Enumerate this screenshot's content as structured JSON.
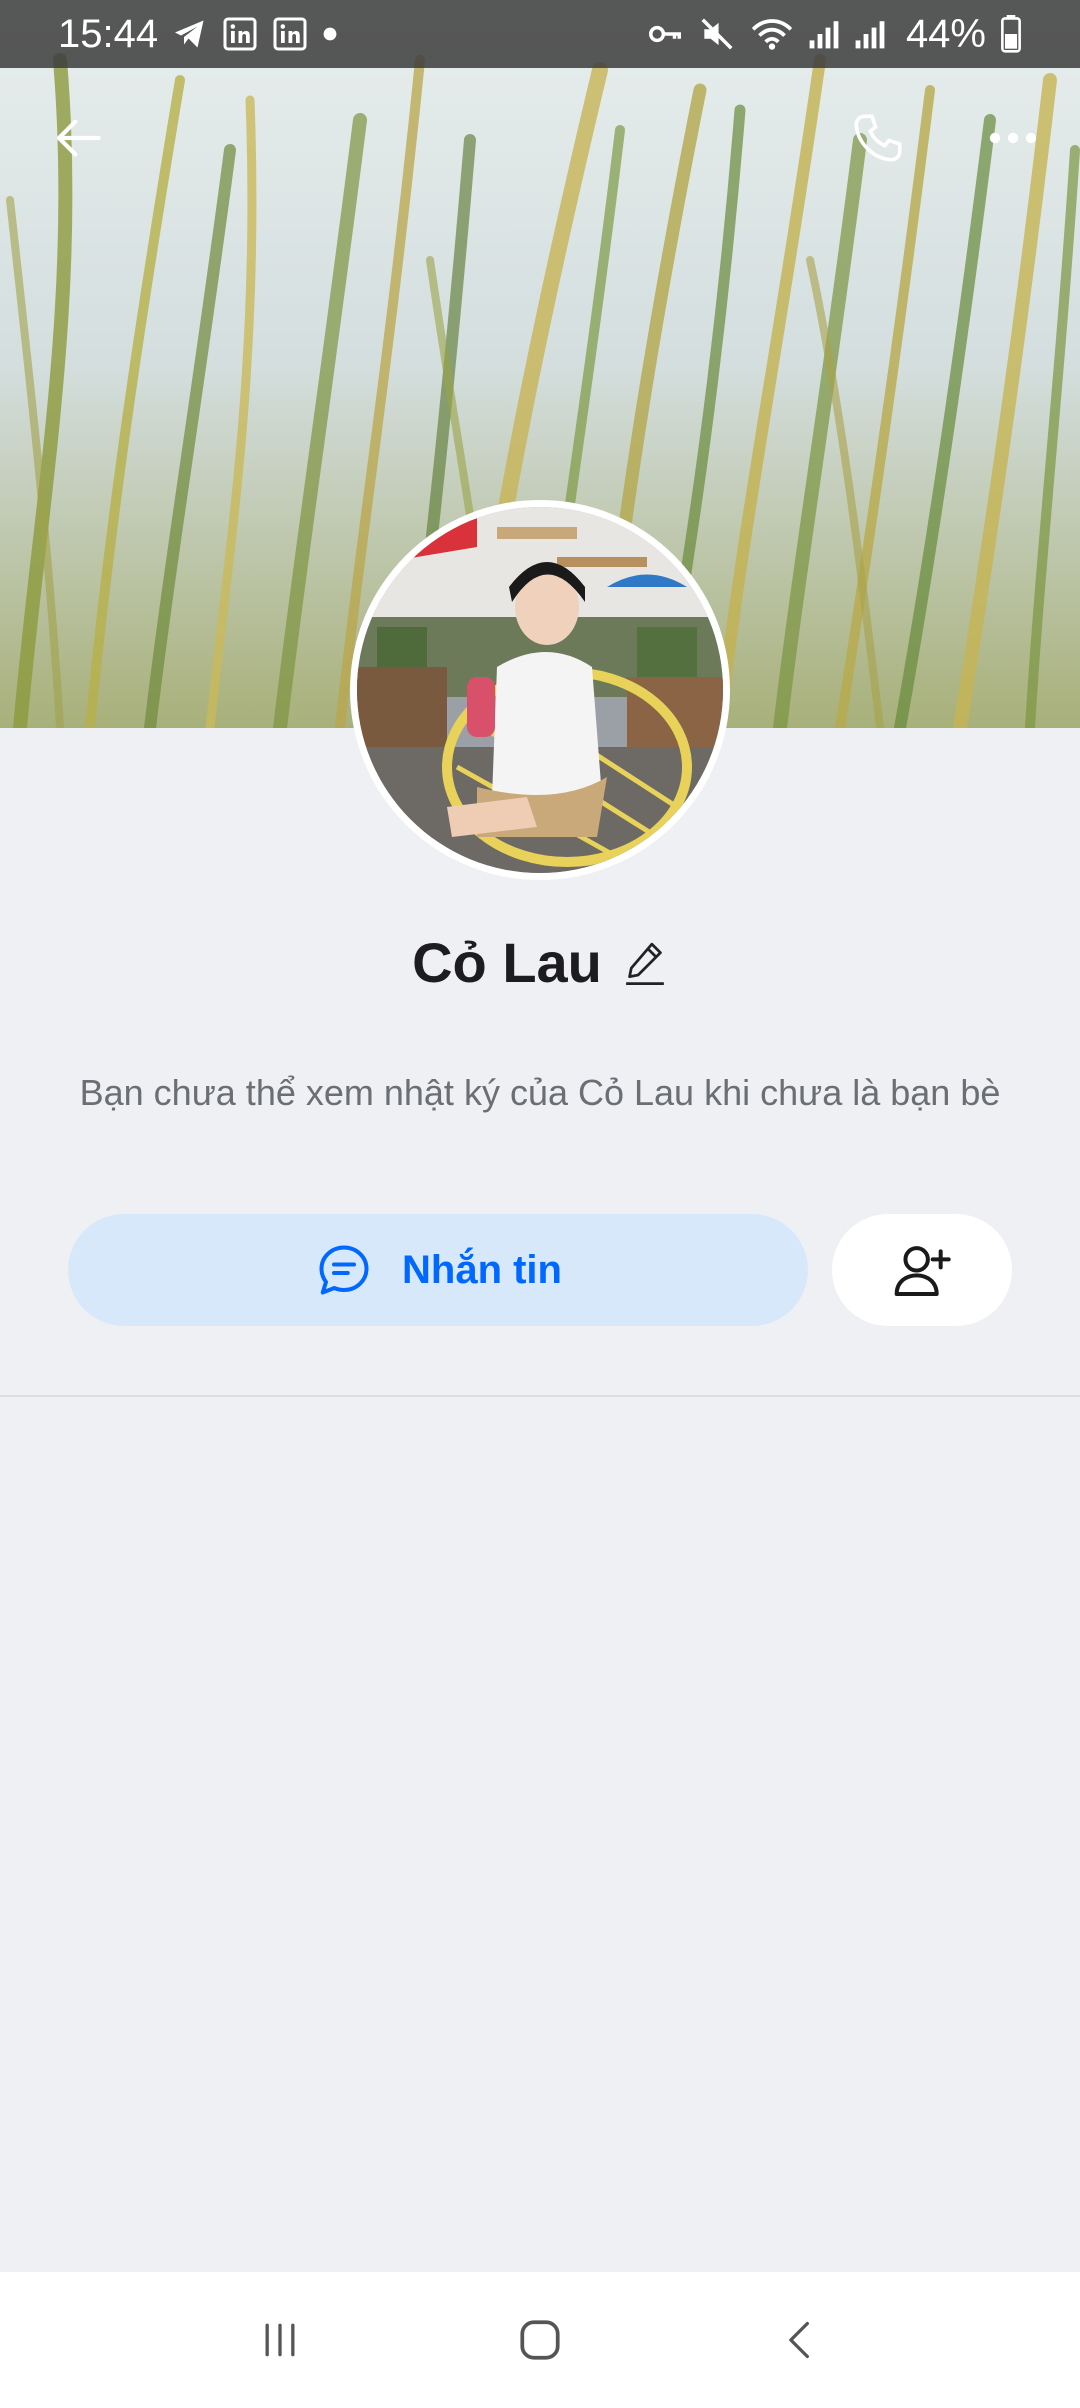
{
  "status_bar": {
    "time": "15:44",
    "battery": "44%",
    "left_icons": [
      "telegram-icon",
      "linkedin-icon",
      "linkedin-icon",
      "dot-icon"
    ],
    "right_icons": [
      "vpn-key-icon",
      "mute-icon",
      "wifi-icon",
      "signal-icon",
      "signal-icon",
      "battery-icon"
    ]
  },
  "header": {
    "back_icon": "arrow-left-icon",
    "call_icon": "phone-icon",
    "more_icon": "more-horizontal-icon"
  },
  "profile": {
    "name": "Cỏ Lau",
    "edit_icon": "pencil-icon",
    "notice": "Bạn chưa thể xem nhật ký của Cỏ Lau khi chưa là bạn bè"
  },
  "actions": {
    "message_label": "Nhắn tin",
    "message_icon": "chat-bubble-icon",
    "add_friend_icon": "add-friend-icon"
  },
  "system_nav": {
    "recents_icon": "recents-icon",
    "home_icon": "home-icon",
    "back_icon": "back-chevron-icon"
  },
  "colors": {
    "accent": "#0068ff",
    "message_button_bg": "#d8e8fb",
    "background": "#eff0f4",
    "name_text": "#1d1d1f",
    "notice_text": "#6b6e73"
  }
}
